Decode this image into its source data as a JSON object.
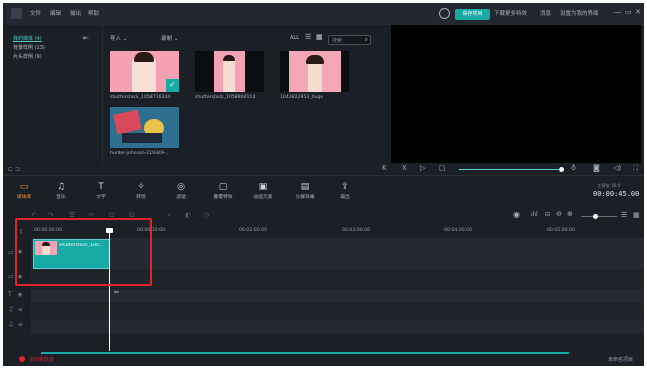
{
  "titlebar": {
    "menu": [
      "文件",
      "编辑",
      "输出",
      "帮助"
    ],
    "save_project": "保存项目",
    "download_more": "下载更多特效",
    "messages": "消息",
    "set_default": "设置为我的界面",
    "win_controls": [
      "—",
      "▭",
      "✕"
    ]
  },
  "media": {
    "folders": [
      {
        "label": "我的媒体 (4)",
        "active": true
      },
      {
        "label": "背景样例 (13)",
        "active": false
      },
      {
        "label": "片头样例 (9)",
        "active": false
      }
    ],
    "import_label": "导入 ⌄",
    "record_label": "录制 ⌄",
    "filter_all": "ALL",
    "search_placeholder": "搜索",
    "items": [
      {
        "label": "shutterstock_1058716244"
      },
      {
        "label": "shutterstock_1058804114"
      },
      {
        "label": "1043822953_huge"
      },
      {
        "label": "hunter-johnson-219349-..."
      }
    ]
  },
  "tools": [
    {
      "label": "媒体库",
      "glyph": "▭",
      "active": true
    },
    {
      "label": "音乐",
      "glyph": "♫",
      "active": false
    },
    {
      "label": "文字",
      "glyph": "T",
      "active": false
    },
    {
      "label": "转场",
      "glyph": "✧",
      "active": false
    },
    {
      "label": "滤镜",
      "glyph": "◎",
      "active": false
    },
    {
      "label": "叠覆特效",
      "glyph": "▢",
      "active": false
    },
    {
      "label": "动画元素",
      "glyph": "▣",
      "active": false
    },
    {
      "label": "分屏效果",
      "glyph": "▤",
      "active": false
    },
    {
      "label": "输出",
      "glyph": "⇪",
      "active": false
    }
  ],
  "timecode": {
    "label": "主预览  16:9",
    "value": "00:00:45.00"
  },
  "ruler": [
    "00:00:00:00",
    "00:00:30:00",
    "00:02:00:00",
    "00:03:00:00",
    "00:04:00:00",
    "00:05:00:00"
  ],
  "clip": {
    "label": "shutterstock_105..."
  },
  "bottom": {
    "add_track": "添加新轨道",
    "unnamed_project": "未命名项目"
  },
  "colors": {
    "accent": "#17a9a4",
    "active_tool": "#f08b3a",
    "highlight_box": "#e0232f"
  }
}
